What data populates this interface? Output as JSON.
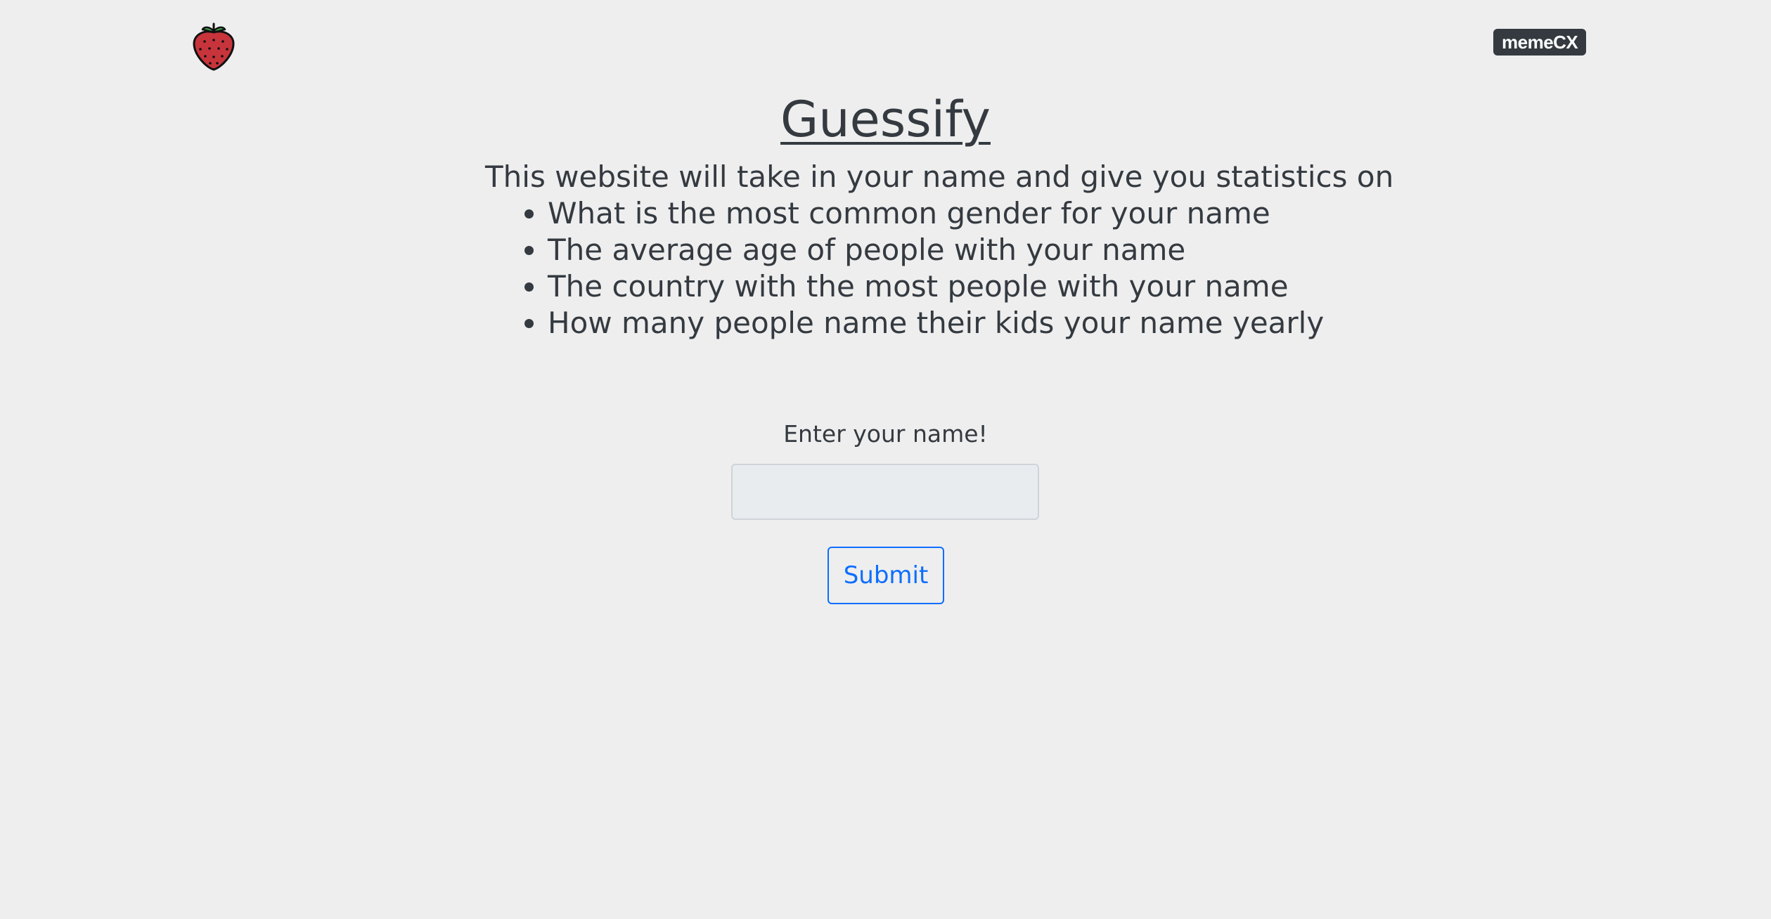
{
  "header": {
    "logo_icon": "strawberry-icon",
    "badge_label": "memeCX"
  },
  "main": {
    "title": "Guessify",
    "intro": "This website will take in your name and give you statistics on",
    "features": [
      "What is the most common gender for your name",
      "The average age of people with your name",
      "The country with the most people with your name",
      "How many people name their kids your name yearly"
    ]
  },
  "form": {
    "label": "Enter your name!",
    "input_value": "",
    "input_placeholder": "",
    "submit_label": "Submit"
  },
  "colors": {
    "background": "#eeeeee",
    "text": "#343a40",
    "badge_bg": "#343a40",
    "primary": "#0d6efd",
    "input_bg": "#e9ecef",
    "strawberry_red": "#c8343b",
    "strawberry_leaf": "#3fa34d"
  }
}
